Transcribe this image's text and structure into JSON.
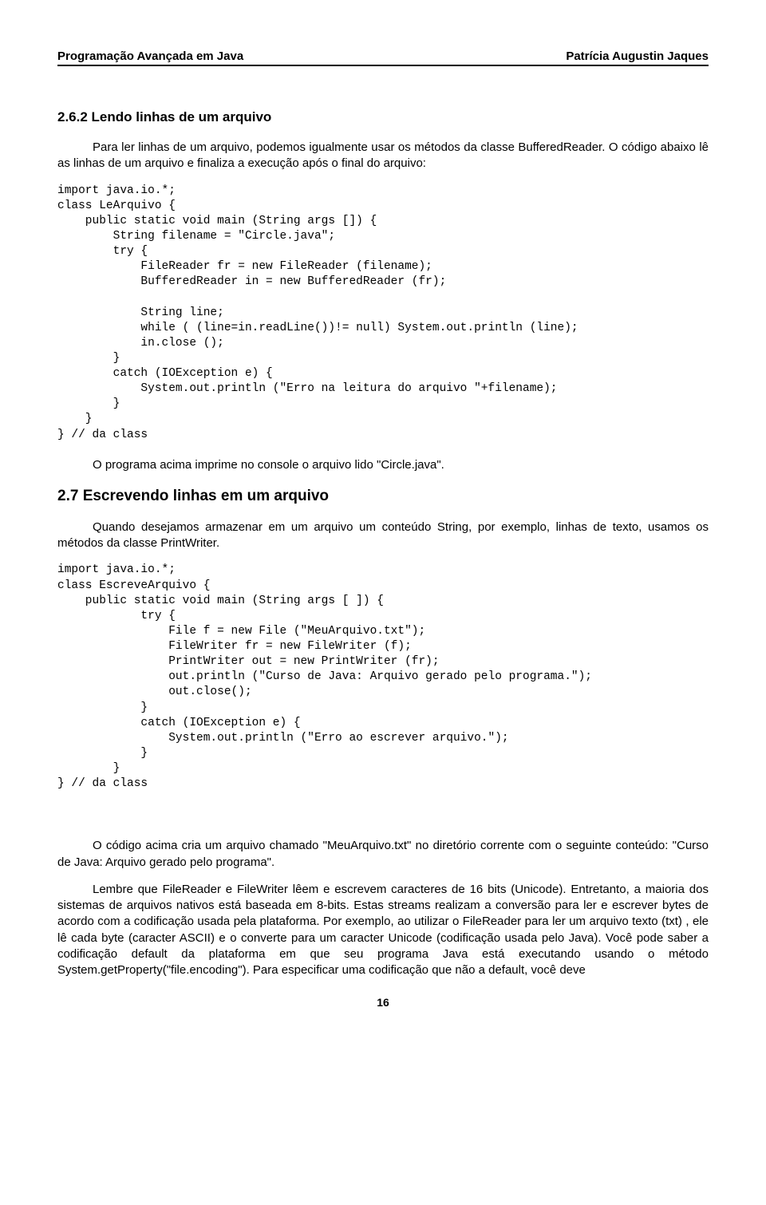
{
  "header": {
    "left": "Programação Avançada em Java",
    "right": "Patrícia Augustin Jaques"
  },
  "section1": {
    "title": "2.6.2 Lendo linhas de um arquivo",
    "para1": "Para ler linhas de um arquivo, podemos igualmente usar os métodos da classe BufferedReader. O código abaixo lê as linhas de um arquivo e finaliza a execução após o final do arquivo:"
  },
  "code1": "import java.io.*;\nclass LeArquivo {\n    public static void main (String args []) {\n        String filename = \"Circle.java\";\n        try {\n            FileReader fr = new FileReader (filename);\n            BufferedReader in = new BufferedReader (fr);\n\n            String line;\n            while ( (line=in.readLine())!= null) System.out.println (line);\n            in.close ();\n        }\n        catch (IOException e) {\n            System.out.println (\"Erro na leitura do arquivo \"+filename);\n        }\n    }\n} // da class",
  "section2": {
    "para_after_code1": "O programa acima imprime no console o arquivo lido \"Circle.java\".",
    "title": "2.7 Escrevendo linhas em um arquivo",
    "para1": "Quando desejamos armazenar em um arquivo um conteúdo String, por exemplo, linhas de texto, usamos os métodos da classe PrintWriter."
  },
  "code2": "import java.io.*;\nclass EscreveArquivo {\n    public static void main (String args [ ]) {\n            try {\n                File f = new File (\"MeuArquivo.txt\");\n                FileWriter fr = new FileWriter (f);\n                PrintWriter out = new PrintWriter (fr);\n                out.println (\"Curso de Java: Arquivo gerado pelo programa.\");\n                out.close();\n            }\n            catch (IOException e) {\n                System.out.println (\"Erro ao escrever arquivo.\");\n            }\n        }\n} // da class",
  "section3": {
    "para1": "O código acima cria um arquivo chamado \"MeuArquivo.txt\" no diretório corrente com o seguinte conteúdo: \"Curso de Java: Arquivo gerado pelo programa\".",
    "para2": "Lembre que FileReader e FileWriter lêem e escrevem caracteres de 16 bits (Unicode). Entretanto, a maioria dos sistemas de arquivos nativos está baseada em 8-bits. Estas streams realizam a conversão para ler e escrever bytes de acordo com a codificação usada pela plataforma. Por exemplo, ao utilizar o FileReader para ler um arquivo texto (txt) , ele lê cada byte (caracter ASCII) e o converte para um caracter Unicode (codificação usada pelo Java). Você pode saber a codificação default da plataforma em que seu programa Java está executando usando o método System.getProperty(\"file.encoding\"). Para especificar uma codificação que não a default, você deve"
  },
  "page_number": "16"
}
